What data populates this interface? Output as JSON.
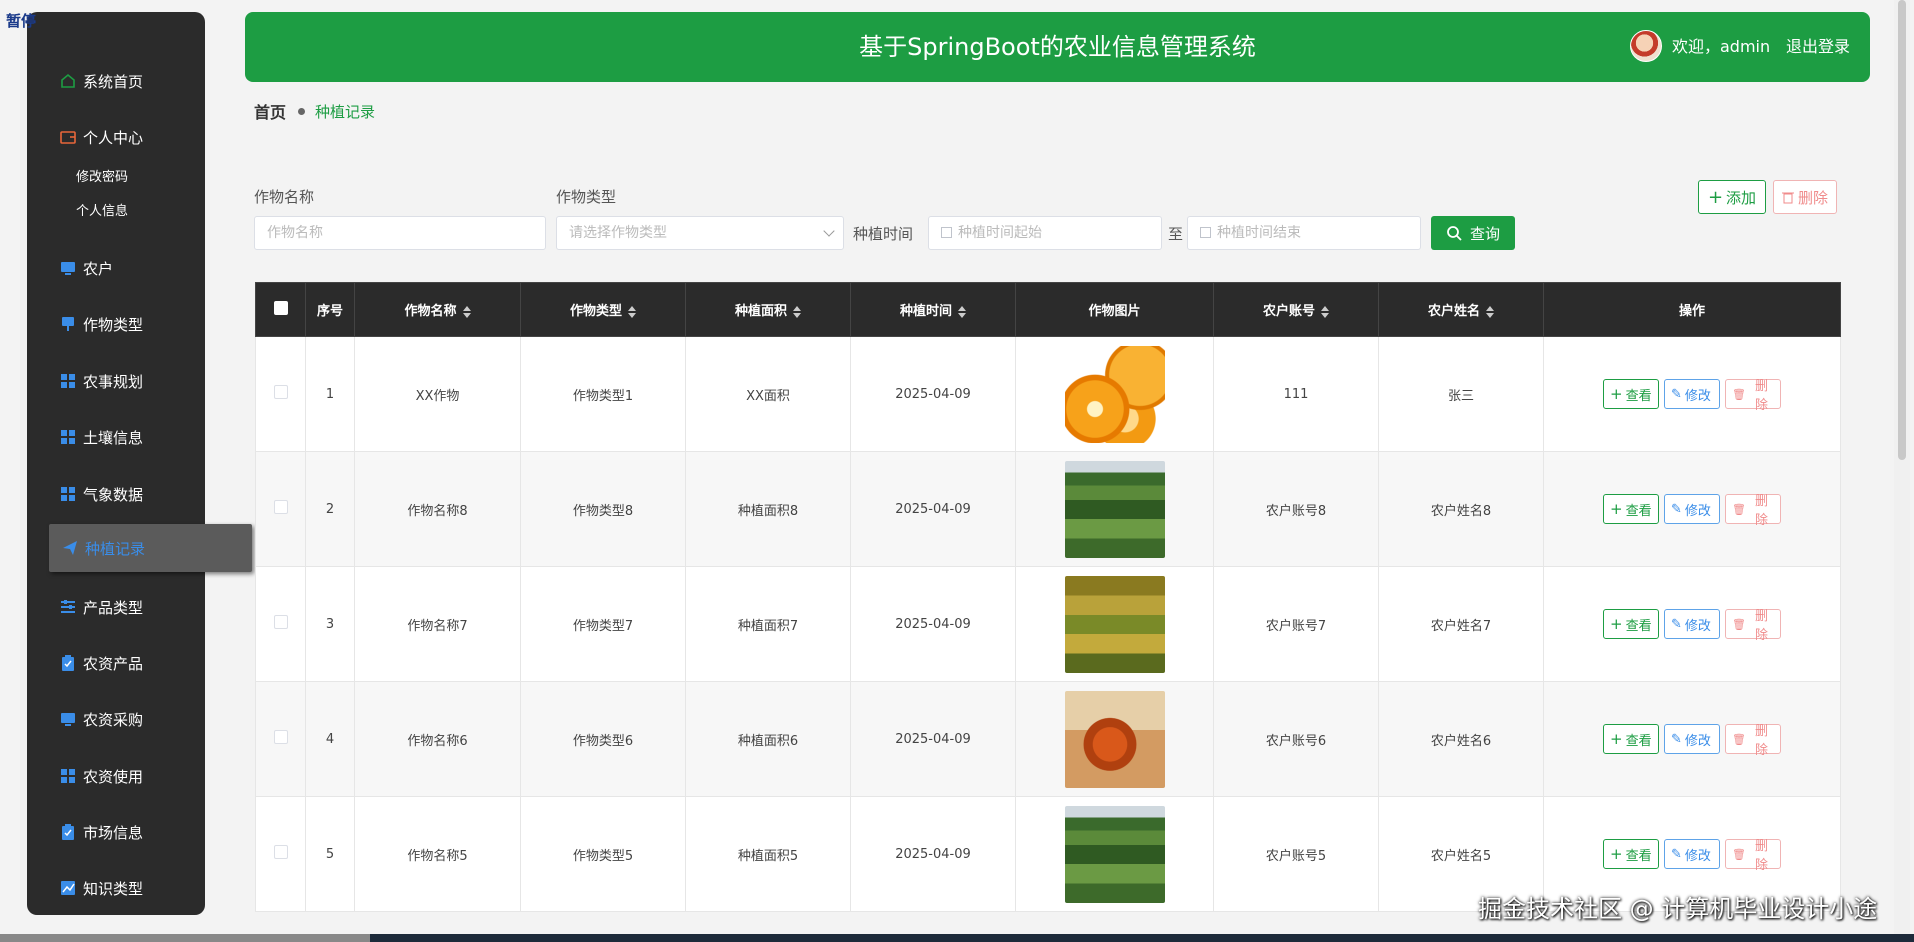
{
  "overlay": {
    "paused_label": "暂停"
  },
  "sidebar": {
    "items": [
      {
        "label": "系统首页",
        "icon": "home-icon"
      },
      {
        "label": "个人中心",
        "icon": "wallet-icon"
      },
      {
        "label": "农户",
        "icon": "monitor-icon"
      },
      {
        "label": "作物类型",
        "icon": "pin-icon"
      },
      {
        "label": "农事规划",
        "icon": "grid-icon"
      },
      {
        "label": "土壤信息",
        "icon": "grid-icon"
      },
      {
        "label": "气象数据",
        "icon": "grid-icon"
      },
      {
        "label": "种植记录",
        "icon": "send-icon"
      },
      {
        "label": "产品类型",
        "icon": "sliders-icon"
      },
      {
        "label": "农资产品",
        "icon": "clipboard-icon"
      },
      {
        "label": "农资采购",
        "icon": "monitor-icon"
      },
      {
        "label": "农资使用",
        "icon": "grid-icon"
      },
      {
        "label": "市场信息",
        "icon": "clipboard-icon"
      },
      {
        "label": "知识类型",
        "icon": "chart-icon"
      }
    ],
    "sub_items": [
      "修改密码",
      "个人信息"
    ]
  },
  "header": {
    "title": "基于SpringBoot的农业信息管理系统",
    "welcome": "欢迎，admin",
    "logout": "退出登录"
  },
  "breadcrumb": {
    "home": "首页",
    "current": "种植记录"
  },
  "search": {
    "crop_name_label": "作物名称",
    "crop_name_placeholder": "作物名称",
    "crop_type_label": "作物类型",
    "crop_type_placeholder": "请选择作物类型",
    "time_label": "种植时间",
    "time_start_placeholder": "种植时间起始",
    "to_label": "至",
    "time_end_placeholder": "种植时间结束",
    "query_label": "查询"
  },
  "actions": {
    "add_label": "添加",
    "delete_label": "删除"
  },
  "table": {
    "headers": [
      "序号",
      "作物名称",
      "作物类型",
      "种植面积",
      "种植时间",
      "作物图片",
      "农户账号",
      "农户姓名",
      "操作"
    ],
    "rows": [
      {
        "no": "1",
        "name": "XX作物",
        "type": "作物类型1",
        "area": "XX面积",
        "date": "2025-04-09",
        "image": "orange",
        "account": "111",
        "farmer": "张三"
      },
      {
        "no": "2",
        "name": "作物名称8",
        "type": "作物类型8",
        "area": "种植面积8",
        "date": "2025-04-09",
        "image": "corn",
        "account": "农户账号8",
        "farmer": "农户姓名8"
      },
      {
        "no": "3",
        "name": "作物名称7",
        "type": "作物类型7",
        "area": "种植面积7",
        "date": "2025-04-09",
        "image": "grain",
        "account": "农户账号7",
        "farmer": "农户姓名7"
      },
      {
        "no": "4",
        "name": "作物名称6",
        "type": "作物类型6",
        "area": "种植面积6",
        "date": "2025-04-09",
        "image": "sorghum",
        "account": "农户账号6",
        "farmer": "农户姓名6"
      },
      {
        "no": "5",
        "name": "作物名称5",
        "type": "作物类型5",
        "area": "种植面积5",
        "date": "2025-04-09",
        "image": "corn",
        "account": "农户账号5",
        "farmer": "农户姓名5"
      }
    ],
    "ops": {
      "view": "查看",
      "edit": "修改",
      "delete": "删除"
    }
  },
  "watermark": "掘金技术社区 @ 计算机毕业设计小途",
  "colors": {
    "primary": "#1d9d43",
    "sidebar_bg": "#2b2b2b",
    "active_text": "#3a8de8",
    "danger": "#f08b8b"
  }
}
